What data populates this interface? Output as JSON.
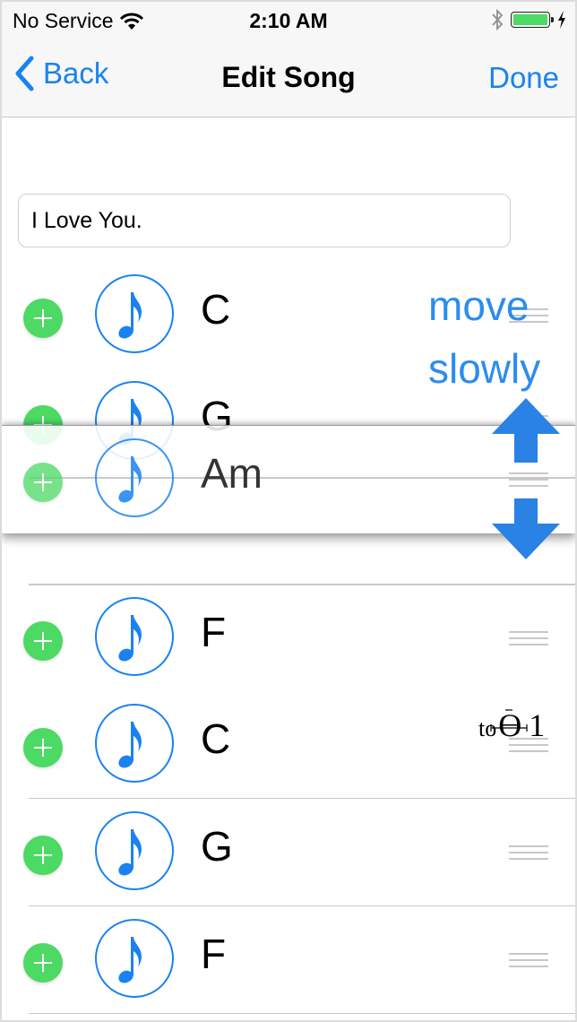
{
  "status_bar": {
    "carrier": "No Service",
    "time": "2:10 AM",
    "icons": [
      "wifi-icon",
      "bluetooth-icon",
      "battery-icon",
      "charging-bolt-icon"
    ],
    "battery_percent": 100,
    "battery_color": "#4cd964"
  },
  "nav": {
    "back_label": "Back",
    "title": "Edit Song",
    "done_label": "Done",
    "accent": "#1a82f0"
  },
  "song_title_field": {
    "value": "I Love You."
  },
  "chords": [
    {
      "name": "C"
    },
    {
      "name": "G"
    },
    {
      "name": "F"
    },
    {
      "name": "C"
    },
    {
      "name": "G"
    },
    {
      "name": "F"
    }
  ],
  "dragged_chord": {
    "name": "Am"
  },
  "annotations": {
    "hint_line1": "move",
    "hint_line2": "slowly",
    "target_prefix": "to",
    "target_symbol": "ϴ",
    "target_suffix": "1",
    "hint_color": "#2b8ded",
    "arrow_color": "#2a82e4"
  },
  "icons": {
    "add": "plus-circle-icon",
    "note": "music-note-icon",
    "reorder": "reorder-handle-icon",
    "back": "chevron-left-icon"
  }
}
